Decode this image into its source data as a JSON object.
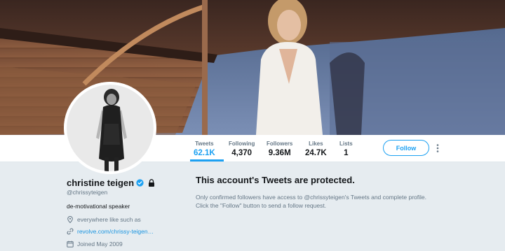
{
  "profile": {
    "name": "christine teigen",
    "handle": "@chrissyteigen",
    "bio": "de-motivational speaker",
    "location": "everywhere like such as",
    "website": "revolve.com/chrissy-teigen…",
    "joined": "Joined May 2009"
  },
  "stats": [
    {
      "label": "Tweets",
      "value": "62.1K",
      "active": true
    },
    {
      "label": "Following",
      "value": "4,370"
    },
    {
      "label": "Followers",
      "value": "9.36M"
    },
    {
      "label": "Likes",
      "value": "24.7K"
    },
    {
      "label": "Lists",
      "value": "1"
    }
  ],
  "actions": {
    "follow_label": "Follow"
  },
  "protected": {
    "title": "This account's Tweets are protected.",
    "line1": "Only confirmed followers have access to @chrissyteigen's Tweets and complete profile.",
    "line2": "Click the \"Follow\" button to send a follow request."
  },
  "colors": {
    "accent": "#1da1f2",
    "link": "#1b95e0",
    "background": "#e6ecf0",
    "text": "#14171a",
    "muted": "#657786"
  },
  "icons": [
    "verified-badge-icon",
    "lock-icon",
    "location-pin-icon",
    "link-icon",
    "calendar-icon",
    "more-vertical-icon"
  ]
}
